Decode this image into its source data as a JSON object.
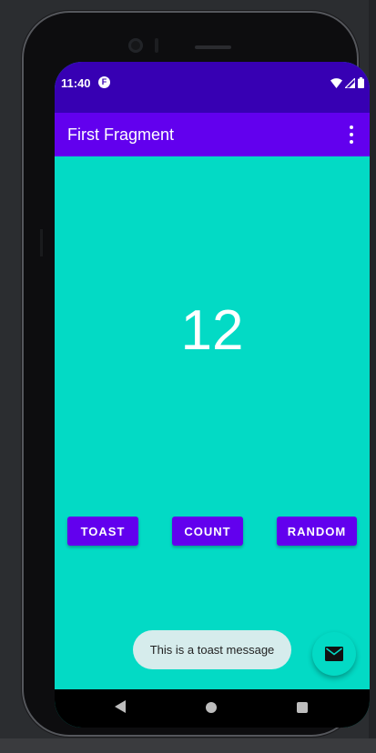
{
  "status_bar": {
    "time": "11:40",
    "app_icon_letter": "F"
  },
  "app_bar": {
    "title": "First Fragment",
    "overflow_icon": "more-vert-icon"
  },
  "content": {
    "count": "12"
  },
  "buttons": {
    "toast": "TOAST",
    "count": "COUNT",
    "random": "RANDOM"
  },
  "toast": {
    "message": "This is a toast message"
  },
  "fab": {
    "icon": "email-icon"
  },
  "colors": {
    "status_bar": "#3700b3",
    "app_bar": "#6200ee",
    "background": "#03dac5",
    "button": "#6200ee"
  },
  "nav_bar": {
    "icons": [
      "back-icon",
      "home-icon",
      "recents-icon"
    ]
  }
}
